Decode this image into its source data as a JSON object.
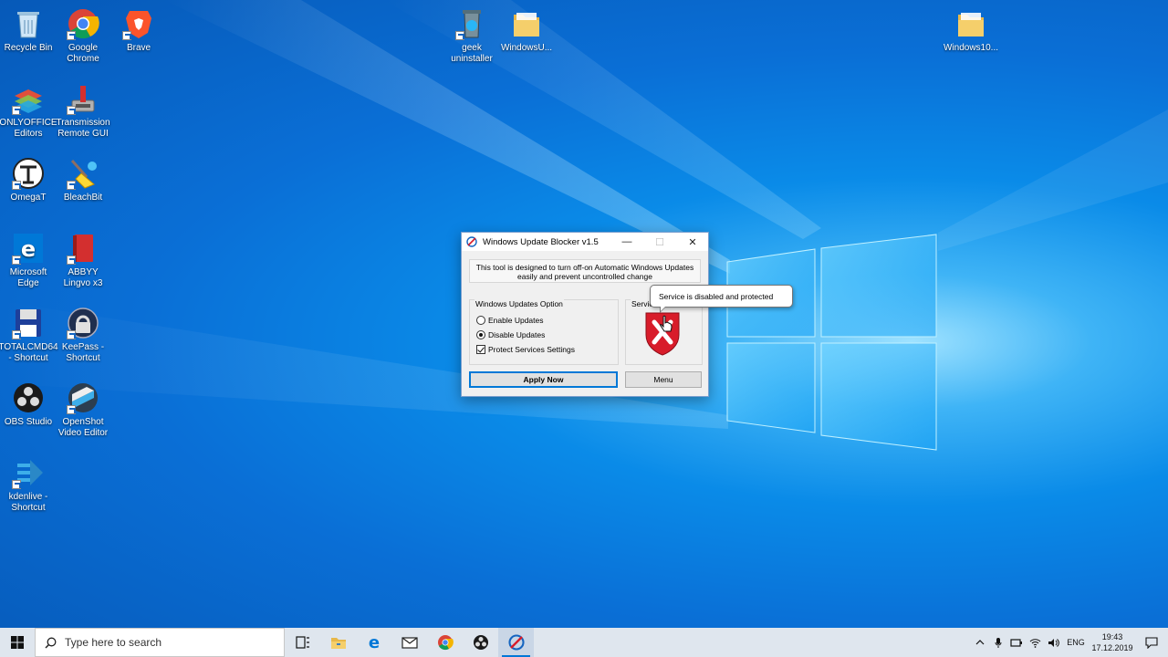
{
  "desktop": {
    "icons": [
      {
        "label": "Recycle Bin",
        "icon": "recycle-bin-icon"
      },
      {
        "label": "Google Chrome",
        "icon": "chrome-icon"
      },
      {
        "label": "Brave",
        "icon": "brave-icon"
      },
      {
        "label": "ONLYOFFICE Editors",
        "icon": "onlyoffice-icon"
      },
      {
        "label": "Transmission Remote GUI",
        "icon": "transmission-icon"
      },
      {
        "label": "OmegaT",
        "icon": "omegat-icon"
      },
      {
        "label": "BleachBit",
        "icon": "bleachbit-icon"
      },
      {
        "label": "Microsoft Edge",
        "icon": "edge-icon"
      },
      {
        "label": "ABBYY Lingvo x3",
        "icon": "abbyy-icon"
      },
      {
        "label": "TOTALCMD64 - Shortcut",
        "icon": "totalcmd-icon"
      },
      {
        "label": "KeePass - Shortcut",
        "icon": "keepass-icon"
      },
      {
        "label": "OBS Studio",
        "icon": "obs-icon"
      },
      {
        "label": "OpenShot Video Editor",
        "icon": "openshot-icon"
      },
      {
        "label": "kdenlive - Shortcut",
        "icon": "kdenlive-icon"
      },
      {
        "label": "geek uninstaller",
        "icon": "geek-uninstaller-icon"
      },
      {
        "label": "WindowsU...",
        "icon": "folder-icon"
      },
      {
        "label": "Windows10...",
        "icon": "folder-icon"
      }
    ]
  },
  "dialog": {
    "title": "Windows Update Blocker v1.5",
    "description": "This tool is designed to turn off-on Automatic Windows Updates easily and prevent uncontrolled change",
    "options_group_label": "Windows Updates Option",
    "options": [
      {
        "label": "Enable Updates",
        "type": "radio",
        "checked": false
      },
      {
        "label": "Disable Updates",
        "type": "radio",
        "checked": true
      },
      {
        "label": "Protect Services Settings",
        "type": "checkbox",
        "checked": true
      }
    ],
    "status_group_label": "Servic",
    "apply_label": "Apply Now",
    "menu_label": "Menu",
    "minimize_glyph": "—",
    "maximize_glyph": "☐",
    "close_glyph": "✕"
  },
  "tooltip": {
    "text": "Service is disabled and protected"
  },
  "taskbar": {
    "search_placeholder": "Type here to search",
    "language": "ENG",
    "time": "19:43",
    "date": "17.12.2019"
  },
  "colors": {
    "accent": "#0078d7",
    "shield": "#d81c2a"
  }
}
